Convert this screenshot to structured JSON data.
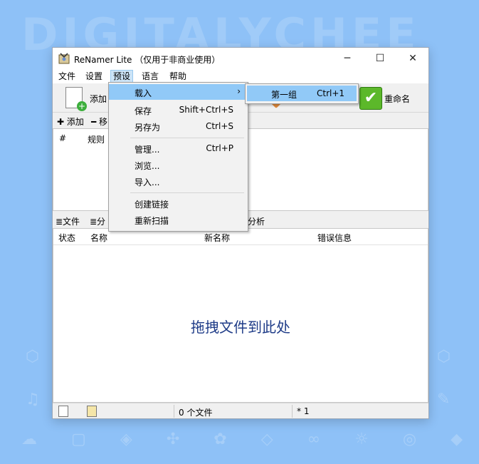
{
  "watermark": "DIGITALYCHEE",
  "window": {
    "title": "ReNamer Lite （仅用于非商业使用）",
    "min_glyph": "─",
    "max_glyph": "☐",
    "close_glyph": "✕"
  },
  "menubar": {
    "items": [
      "文件",
      "设置",
      "预设",
      "语言",
      "帮助"
    ],
    "active_index": 2
  },
  "toolbar": {
    "add_label": "添加",
    "rename_label": "重命名"
  },
  "rules": {
    "add_button": "✚ 添加",
    "remove_button": "━ 移",
    "columns": [
      "#",
      "规则"
    ]
  },
  "files": {
    "tab_files": "≣文件",
    "tab_filter": "≣分",
    "tab_analyze": "分析",
    "columns": [
      "状态",
      "名称",
      "新名称",
      "错误信息"
    ],
    "drop_hint": "拖拽文件到此处"
  },
  "statusbar": {
    "count": "0 个文件",
    "marker": "* 1"
  },
  "preset_menu": {
    "items": [
      {
        "label": "载入",
        "shortcut": "",
        "submenu": true
      },
      {
        "label": "保存",
        "shortcut": "Shift+Ctrl+S"
      },
      {
        "label": "另存为",
        "shortcut": "Ctrl+S"
      },
      {
        "label": "管理...",
        "shortcut": "Ctrl+P"
      },
      {
        "label": "浏览...",
        "shortcut": ""
      },
      {
        "label": "导入...",
        "shortcut": ""
      },
      {
        "label": "创建链接",
        "shortcut": ""
      },
      {
        "label": "重新扫描",
        "shortcut": ""
      }
    ],
    "submenu_arrow": "›"
  },
  "load_submenu": {
    "items": [
      {
        "label": "第一组",
        "shortcut": "Ctrl+1"
      }
    ]
  },
  "colors": {
    "background": "#8ec1f7",
    "highlight": "#91c9f7",
    "drop_text": "#1f3c88",
    "accent_green": "#5cb82a"
  }
}
